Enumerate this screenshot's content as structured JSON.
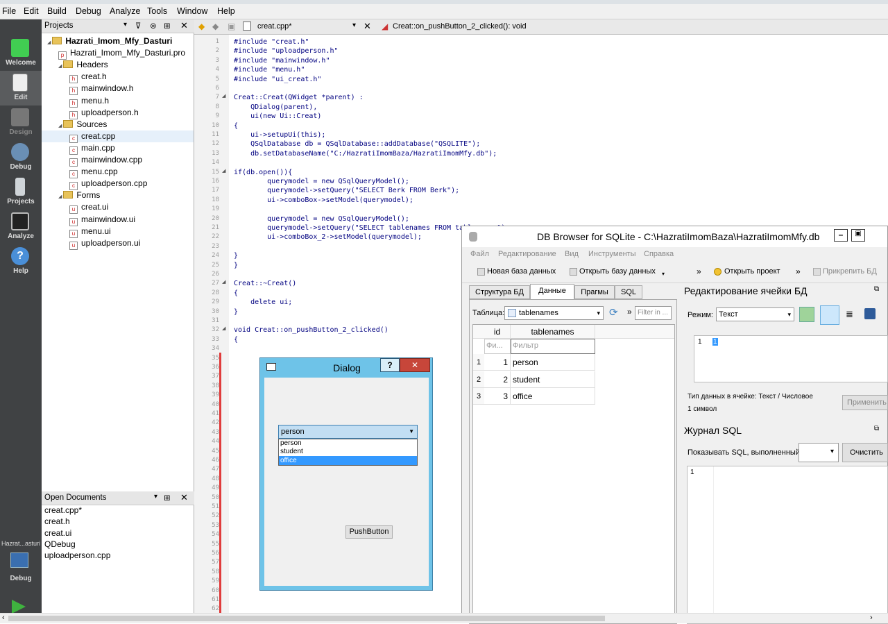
{
  "menubar": {
    "items": [
      "File",
      "Edit",
      "Build",
      "Debug",
      "Analyze",
      "Tools",
      "Window",
      "Help"
    ]
  },
  "modes": [
    {
      "label": "Welcome",
      "icon": "qt-logo-icon"
    },
    {
      "label": "Edit",
      "icon": "document-edit-icon"
    },
    {
      "label": "Design",
      "icon": "design-pen-icon"
    },
    {
      "label": "Debug",
      "icon": "debug-bug-icon"
    },
    {
      "label": "Projects",
      "icon": "projects-wrench-icon"
    },
    {
      "label": "Analyze",
      "icon": "analyze-monitor-icon"
    },
    {
      "label": "Help",
      "icon": "help-question-icon"
    }
  ],
  "kit": {
    "target": "Hazrat...asturi",
    "build": "Debug"
  },
  "projects_pane": {
    "title": "Projects",
    "tree": [
      {
        "text": "Hazrati_Imom_Mfy_Dasturi",
        "level": 0,
        "kind": "project",
        "bold": true
      },
      {
        "text": "Hazrati_Imom_Mfy_Dasturi.pro",
        "level": 1,
        "kind": "pro"
      },
      {
        "text": "Headers",
        "level": 1,
        "kind": "folder"
      },
      {
        "text": "creat.h",
        "level": 2,
        "kind": "h"
      },
      {
        "text": "mainwindow.h",
        "level": 2,
        "kind": "h"
      },
      {
        "text": "menu.h",
        "level": 2,
        "kind": "h"
      },
      {
        "text": "uploadperson.h",
        "level": 2,
        "kind": "h"
      },
      {
        "text": "Sources",
        "level": 1,
        "kind": "folder"
      },
      {
        "text": "creat.cpp",
        "level": 2,
        "kind": "cpp",
        "selected": true
      },
      {
        "text": "main.cpp",
        "level": 2,
        "kind": "cpp"
      },
      {
        "text": "mainwindow.cpp",
        "level": 2,
        "kind": "cpp"
      },
      {
        "text": "menu.cpp",
        "level": 2,
        "kind": "cpp"
      },
      {
        "text": "uploadperson.cpp",
        "level": 2,
        "kind": "cpp"
      },
      {
        "text": "Forms",
        "level": 1,
        "kind": "folder"
      },
      {
        "text": "creat.ui",
        "level": 2,
        "kind": "ui"
      },
      {
        "text": "mainwindow.ui",
        "level": 2,
        "kind": "ui"
      },
      {
        "text": "menu.ui",
        "level": 2,
        "kind": "ui"
      },
      {
        "text": "uploadperson.ui",
        "level": 2,
        "kind": "ui"
      }
    ]
  },
  "open_documents": {
    "title": "Open Documents",
    "items": [
      "creat.cpp*",
      "creat.h",
      "creat.ui",
      "QDebug",
      "uploadperson.cpp"
    ]
  },
  "editor": {
    "file": "creat.cpp*",
    "symbol": "Creat::on_pushButton_2_clicked(): void",
    "lines": [
      "#include \"creat.h\"",
      "#include \"uploadperson.h\"",
      "#include \"mainwindow.h\"",
      "#include \"menu.h\"",
      "#include \"ui_creat.h\"",
      "",
      "Creat::Creat(QWidget *parent) :",
      "    QDialog(parent),",
      "    ui(new Ui::Creat)",
      "{",
      "    ui->setupUi(this);",
      "    QSqlDatabase db = QSqlDatabase::addDatabase(\"QSQLITE\");",
      "    db.setDatabaseName(\"C:/HazratiImomBaza/HazratiImomMfy.db\");",
      "",
      "if(db.open()){",
      "        querymodel = new QSqlQueryModel();",
      "        querymodel->setQuery(\"SELECT Berk FROM Berk\");",
      "        ui->comboBox->setModel(querymodel);",
      "",
      "        querymodel = new QSqlQueryModel();",
      "        querymodel->setQuery(\"SELECT tablenames FROM tablenames\");",
      "        ui->comboBox_2->setModel(querymodel);",
      "",
      "}",
      "}",
      "",
      "Creat::~Creat()",
      "{",
      "    delete ui;",
      "}",
      "",
      "void Creat::on_pushButton_2_clicked()",
      "{"
    ],
    "line_count": 62
  },
  "dialog": {
    "title": "Dialog",
    "help": "?",
    "close": "✕",
    "combo_value": "person",
    "options": [
      "person",
      "student",
      "office"
    ],
    "highlighted": "office",
    "button": "PushButton"
  },
  "dbbrowser": {
    "title": "DB Browser for SQLite - C:\\HazratiImomBaza\\HazratiImomMfy.db",
    "menu": [
      "Файл",
      "Редактирование",
      "Вид",
      "Инструменты",
      "Справка"
    ],
    "toolbar": [
      "Новая база данных",
      "Открыть базу данных",
      "Открыть проект",
      "Прикрепить БД"
    ],
    "tabs": [
      "Структура БД",
      "Данные",
      "Прагмы",
      "SQL"
    ],
    "active_tab": "Данные",
    "table_label": "Таблица:",
    "table_value": "tablenames",
    "filter_placeholder": "Filter in ...",
    "columns": [
      "id",
      "tablenames"
    ],
    "filter_row": [
      "Фи...",
      "Фильтр"
    ],
    "rows": [
      [
        "1",
        "1",
        "person"
      ],
      [
        "2",
        "2",
        "student"
      ],
      [
        "3",
        "3",
        "office"
      ]
    ],
    "edit_cell": {
      "title": "Редактирование ячейки БД",
      "mode_label": "Режим:",
      "mode_value": "Текст",
      "line": "1",
      "value": "1",
      "type_info": "Тип данных в ячейке: Текст / Числовое",
      "size_info": "1 символ",
      "apply": "Применить"
    },
    "sql_log": {
      "title": "Журнал SQL",
      "show_label": "Показывать SQL, выполненный",
      "clear": "Очистить",
      "line": "1"
    }
  },
  "colors": {
    "dialog_frame": "#6ec3e8",
    "dialog_close": "#c7463a",
    "highlight": "#3399ff",
    "mode_bar": "#404244"
  }
}
